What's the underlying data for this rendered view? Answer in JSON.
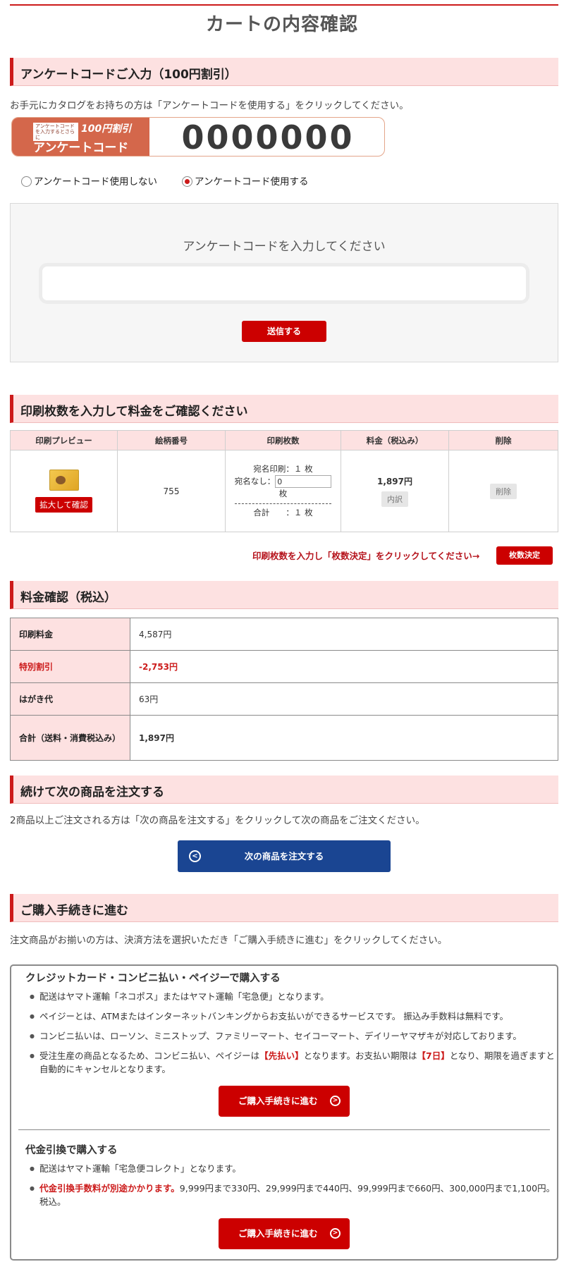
{
  "page_title": "カートの内容確認",
  "survey": {
    "heading": "アンケートコードご入力（100円割引）",
    "intro": "お手元にカタログをお持ちの方は「アンケートコードを使用する」をクリックしてください。",
    "banner_small": "アンケートコードを入力するとさらに",
    "banner_discount": "100円割引",
    "banner_label": "アンケートコード",
    "banner_code": "0000000",
    "radio_no": "アンケートコード使用しない",
    "radio_yes": "アンケートコード使用する",
    "selected": "yes",
    "prompt": "アンケートコードを入力してください",
    "input_value": "",
    "send_label": "送信する"
  },
  "print": {
    "heading": "印刷枚数を入力して料金をご確認ください",
    "columns": [
      "印刷プレビュー",
      "絵柄番号",
      "印刷枚数",
      "料金（税込み）",
      "削除"
    ],
    "zoom_label": "拡大して確認",
    "design_no": "755",
    "addr_print_label": "宛名印刷：",
    "addr_print_qty": "１ 枚",
    "no_addr_label": "宛名なし：",
    "no_addr_value": "0",
    "no_addr_unit": "枚",
    "total_label": "合計　　：",
    "total_qty": "１ 枚",
    "price": "1,897円",
    "breakdown_label": "内訳",
    "delete_label": "削除",
    "decide_text": "印刷枚数を入力し「枚数決定」をクリックしてください→",
    "decide_label": "枚数決定"
  },
  "fee": {
    "heading": "料金確認（税込）",
    "rows": [
      {
        "label": "印刷料金",
        "value": "4,587円"
      },
      {
        "label": "特別割引",
        "value": "-2,753円"
      },
      {
        "label": "はがき代",
        "value": "63円"
      },
      {
        "label": "合計（送料・消費税込み）",
        "value": "1,897円"
      }
    ]
  },
  "next": {
    "heading": "続けて次の商品を注文する",
    "text": "2商品以上ご注文される方は「次の商品を注文する」をクリックして次の商品をご注文ください。",
    "button_label": "次の商品を注文する"
  },
  "purchase": {
    "heading": "ご購入手続きに進む",
    "text": "注文商品がお揃いの方は、決済方法を選択いただき「ご購入手続きに進む」をクリックしてください。",
    "card": {
      "title": "クレジットカード・コンビニ払い・ペイジーで購入する",
      "item1": "配送はヤマト運輸「ネコポス」またはヤマト運輸「宅急便」となります。",
      "item2": "ペイジーとは、ATMまたはインターネットバンキングからお支払いができるサービスです。 振込み手数料は無料です。",
      "item3": "コンビニ払いは、ローソン、ミニストップ、ファミリーマート、セイコーマート、デイリーヤマザキが対応しております。",
      "item4_a": "受注生産の商品となるため、コンビニ払い、ペイジーは",
      "item4_em1": "【先払い】",
      "item4_b": "となります。お支払い期限は",
      "item4_em2": "【7日】",
      "item4_c": "となり、期限を過ぎますと自動的にキャンセルとなります。",
      "button_label": "ご購入手続きに進む"
    },
    "cod": {
      "title": "代金引換で購入する",
      "item1": "配送はヤマト運輸「宅急便コレクト」となります。",
      "item2_em": "代金引換手数料が別途かかります。",
      "item2_rest": "9,999円まで330円、29,999円まで440円、99,999円まで660円、300,000円まで1,100円。税込。",
      "button_label": "ご購入手続きに進む"
    }
  },
  "colors": {
    "accent": "#cc0000",
    "header_bg": "#fde1e1",
    "navy": "#1a4592"
  }
}
